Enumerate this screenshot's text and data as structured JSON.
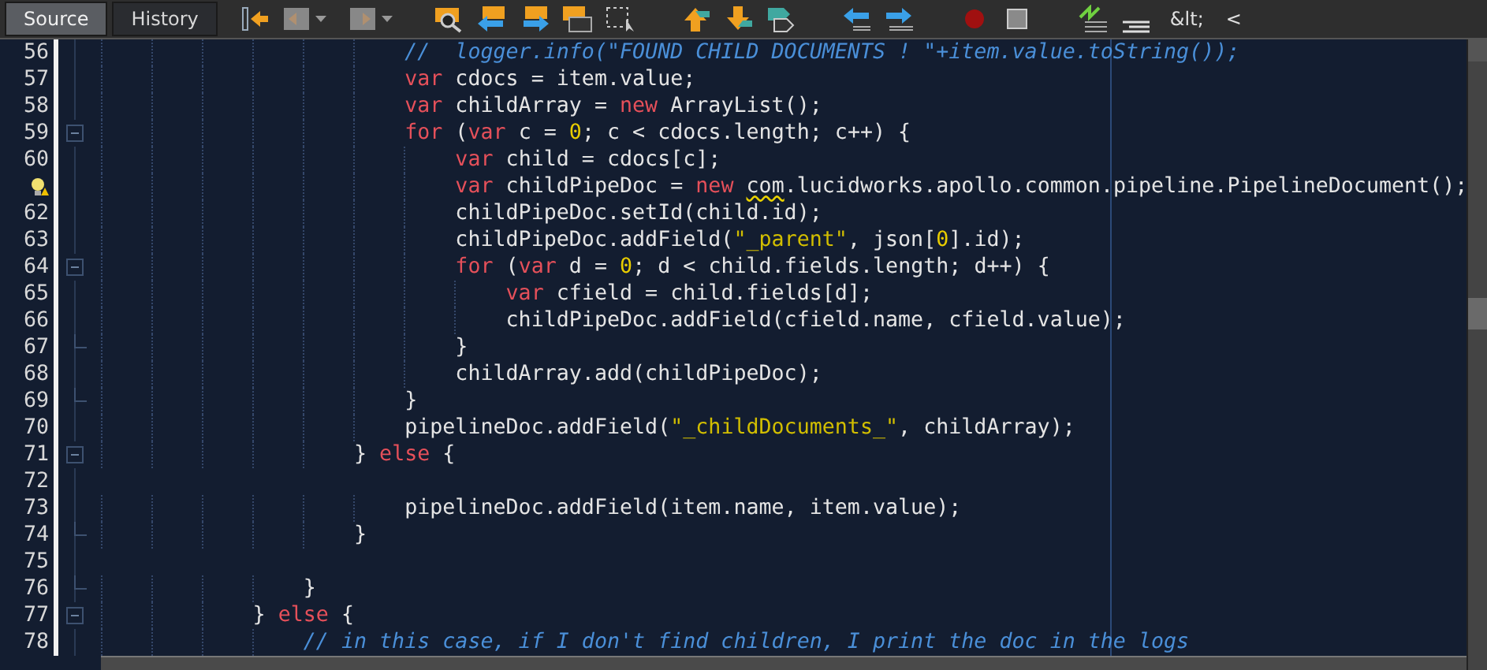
{
  "tabs": [
    {
      "label": "Source",
      "selected": true
    },
    {
      "label": "History",
      "selected": false
    }
  ],
  "toolbar_texts": [
    "&lt;",
    "<"
  ],
  "lines": [
    {
      "number": "56",
      "kind": "line",
      "segments": [
        {
          "text": "                        //  logger.info(\"FOUND CHILD DOCUMENTS ! \"+item.value.toString());",
          "kind": "comment"
        }
      ]
    },
    {
      "number": "57",
      "kind": "line",
      "segments": [
        {
          "text": "                        var",
          "kind": "keyword"
        },
        {
          "text": " cdocs = item.value;",
          "kind": "plain"
        }
      ]
    },
    {
      "number": "58",
      "kind": "line",
      "segments": [
        {
          "text": "                        var",
          "kind": "keyword"
        },
        {
          "text": " childArray = ",
          "kind": "plain"
        },
        {
          "text": "new",
          "kind": "keyword"
        },
        {
          "text": " ArrayList();",
          "kind": "plain"
        }
      ]
    },
    {
      "number": "59",
      "kind": "fold_start",
      "segments": [
        {
          "text": "                        for",
          "kind": "keyword"
        },
        {
          "text": " (",
          "kind": "plain"
        },
        {
          "text": "var",
          "kind": "keyword"
        },
        {
          "text": " c = ",
          "kind": "plain"
        },
        {
          "text": "0",
          "kind": "number"
        },
        {
          "text": "; c < cdocs.length; c++) {",
          "kind": "plain"
        }
      ]
    },
    {
      "number": "60",
      "kind": "line",
      "segments": [
        {
          "text": "                            var",
          "kind": "keyword"
        },
        {
          "text": " child = cdocs[c];",
          "kind": "plain"
        }
      ]
    },
    {
      "hint": true,
      "kind": "line",
      "segments": [
        {
          "text": "                            var",
          "kind": "keyword"
        },
        {
          "text": " childPipeDoc = ",
          "kind": "plain"
        },
        {
          "text": "new ",
          "kind": "keyword"
        },
        {
          "text": "com",
          "kind": "warning"
        },
        {
          "text": ".lucidworks.apollo.common.pipeline.PipelineDocument();",
          "kind": "plain"
        }
      ]
    },
    {
      "number": "62",
      "kind": "line",
      "segments": [
        {
          "text": "                            childPipeDoc.setId(child.id);",
          "kind": "plain"
        }
      ]
    },
    {
      "number": "63",
      "kind": "line",
      "segments": [
        {
          "text": "                            childPipeDoc.addField(",
          "kind": "plain"
        },
        {
          "text": "\"_parent\"",
          "kind": "string"
        },
        {
          "text": ", json[",
          "kind": "plain"
        },
        {
          "text": "0",
          "kind": "number"
        },
        {
          "text": "].id);",
          "kind": "plain"
        }
      ]
    },
    {
      "number": "64",
      "kind": "fold_start",
      "segments": [
        {
          "text": "                            for",
          "kind": "keyword"
        },
        {
          "text": " (",
          "kind": "plain"
        },
        {
          "text": "var",
          "kind": "keyword"
        },
        {
          "text": " d = ",
          "kind": "plain"
        },
        {
          "text": "0",
          "kind": "number"
        },
        {
          "text": "; d < child.fields.length; d++) {",
          "kind": "plain"
        }
      ]
    },
    {
      "number": "65",
      "kind": "line",
      "segments": [
        {
          "text": "                                var",
          "kind": "keyword"
        },
        {
          "text": " cfield = child.fields[d];",
          "kind": "plain"
        }
      ]
    },
    {
      "number": "66",
      "kind": "line",
      "segments": [
        {
          "text": "                                childPipeDoc.addField(cfield.name, cfield.value);",
          "kind": "plain"
        }
      ]
    },
    {
      "number": "67",
      "kind": "fold_end",
      "segments": [
        {
          "text": "                            }",
          "kind": "plain"
        }
      ]
    },
    {
      "number": "68",
      "kind": "line",
      "segments": [
        {
          "text": "                            childArray.add(childPipeDoc);",
          "kind": "plain"
        }
      ]
    },
    {
      "number": "69",
      "kind": "fold_end",
      "segments": [
        {
          "text": "                        }",
          "kind": "plain"
        }
      ]
    },
    {
      "number": "70",
      "kind": "line",
      "segments": [
        {
          "text": "                        pipelineDoc.addField(",
          "kind": "plain"
        },
        {
          "text": "\"_childDocuments_\"",
          "kind": "string"
        },
        {
          "text": ", childArray);",
          "kind": "plain"
        }
      ]
    },
    {
      "number": "71",
      "kind": "fold_start",
      "segments": [
        {
          "text": "                    } ",
          "kind": "plain"
        },
        {
          "text": "else",
          "kind": "keyword"
        },
        {
          "text": " {",
          "kind": "plain"
        }
      ]
    },
    {
      "number": "72",
      "kind": "line"
    },
    {
      "number": "73",
      "kind": "line",
      "segments": [
        {
          "text": "                        pipelineDoc.addField(item.name, item.value);",
          "kind": "plain"
        }
      ]
    },
    {
      "number": "74",
      "kind": "fold_end",
      "segments": [
        {
          "text": "                    }",
          "kind": "plain"
        }
      ]
    },
    {
      "number": "75",
      "kind": "line"
    },
    {
      "number": "76",
      "kind": "fold_end",
      "segments": [
        {
          "text": "                }",
          "kind": "plain"
        }
      ]
    },
    {
      "number": "77",
      "kind": "fold_start",
      "segments": [
        {
          "text": "            } ",
          "kind": "plain"
        },
        {
          "text": "else",
          "kind": "keyword"
        },
        {
          "text": " {",
          "kind": "plain"
        }
      ]
    },
    {
      "number": "78",
      "kind": "line",
      "segments": [
        {
          "text": "                // in this case, if I don't find children, I print the doc in the logs",
          "kind": "comment"
        }
      ]
    }
  ]
}
